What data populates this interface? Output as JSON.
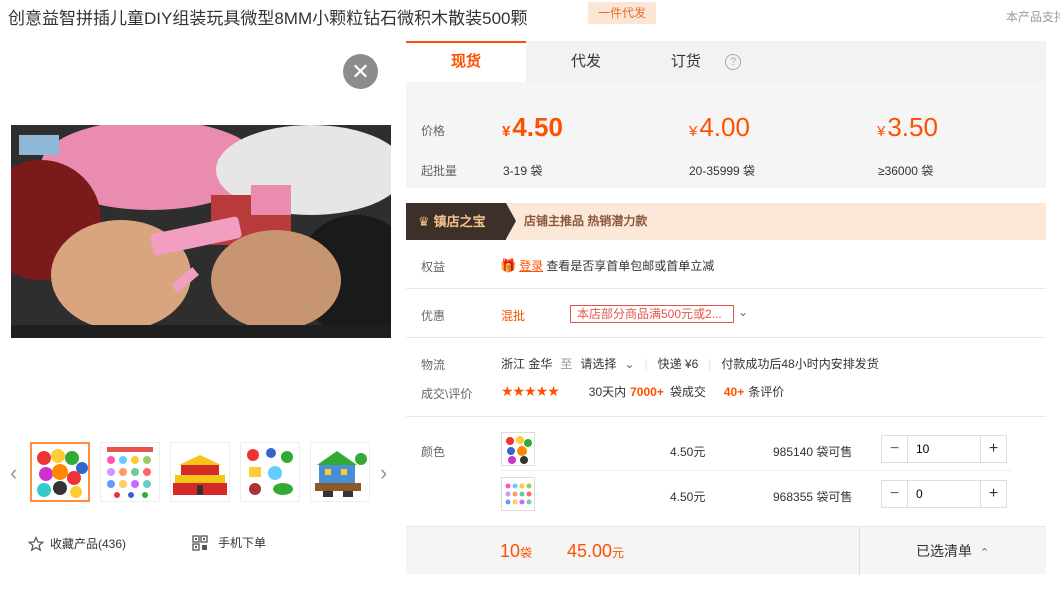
{
  "header": {
    "title": "创意益智拼插儿童DIY组装玩具微型8MM小颗粒钻石微积木散装500颗",
    "badge": "一件代发",
    "support_text": "本产品支持"
  },
  "media": {
    "close_icon": "close-icon",
    "close_glyph": "✕",
    "prev_glyph": "‹",
    "next_glyph": "›"
  },
  "actions": {
    "favorite_label": "收藏产品(436)",
    "mobile_order_label": "手机下单"
  },
  "tabs": [
    {
      "label": "现货",
      "active": true
    },
    {
      "label": "代发",
      "active": false
    },
    {
      "label": "订货",
      "active": false
    }
  ],
  "help_glyph": "?",
  "pricing": {
    "price_label": "价格",
    "min_qty_label": "起批量",
    "currency": "¥",
    "tiers": [
      {
        "price": "4.50",
        "qty": "3-19 袋"
      },
      {
        "price": "4.00",
        "qty": "20-35999 袋"
      },
      {
        "price": "3.50",
        "qty": "≥36000 袋"
      }
    ]
  },
  "promo": {
    "tag": "镇店之宝",
    "text": "店铺主推品   热销潜力款"
  },
  "benefits": {
    "label": "权益",
    "login_link": "登录",
    "text": "查看是否享首单包邮或首单立减"
  },
  "discount": {
    "label": "优惠",
    "mixed": "混批",
    "box_text": "本店部分商品满500元或2..."
  },
  "logistics": {
    "label": "物流",
    "origin": "浙江 金华",
    "to": "至",
    "select": "请选择",
    "express": "快递 ¥6",
    "ship_note": "付款成功后48小时内安排发货"
  },
  "reviews": {
    "label": "成交\\评价",
    "stars": "★★★★★",
    "sales_prefix": "30天内",
    "sales_count": "7000+",
    "sales_suffix": "袋成交",
    "review_count": "40+",
    "review_suffix": "条评价"
  },
  "sku": {
    "label": "颜色",
    "rows": [
      {
        "price": "4.50元",
        "stock": "985140 袋可售",
        "qty": "10"
      },
      {
        "price": "4.50元",
        "stock": "968355 袋可售",
        "qty": "0"
      }
    ]
  },
  "footer": {
    "qty": "10",
    "qty_unit": "袋",
    "total": "45.00",
    "total_unit": "元",
    "selected_label": "已选清单",
    "caret": "⌃"
  },
  "colors": {
    "accent": "#ff5000",
    "tab_bg": "#f2f2f2",
    "promo_bg": "#fbe8d9"
  }
}
